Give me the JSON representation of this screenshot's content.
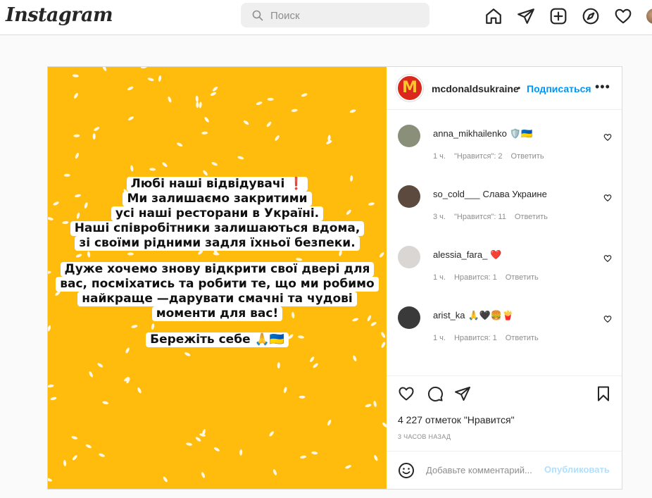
{
  "app": {
    "logo": "Instagram",
    "search_placeholder": "Поиск"
  },
  "nav_icons": [
    "home-icon",
    "direct-send-icon",
    "new-post-icon",
    "explore-compass-icon",
    "activity-heart-icon",
    "profile-avatar"
  ],
  "post": {
    "background_color": "#ffbc0d",
    "text_groups": [
      [
        "Любі наші відвідувачі ❗",
        "Ми залишаємо закритими",
        "усі наші ресторани в Україні.",
        "Наші співробітники залишаються вдома,",
        "зі своїми рідними задля їхньої безпеки."
      ],
      [
        "Дуже хочемо знову відкрити свої двері для",
        "вас, посміхатись та робити те, що ми робимо",
        "найкраще —дарувати смачні та чудові",
        "моменти для вас!"
      ],
      [
        "Бережіть себе 🙏🇺🇦"
      ]
    ],
    "author": "mcdonaldsukraine",
    "separator": "•",
    "follow_label": "Подписаться",
    "more_label": "•••",
    "likes_text": "4 227 отметок \"Нравится\"",
    "time_text": "3 ЧАСОВ НАЗАД",
    "comment_placeholder": "Добавьте комментарий...",
    "publish_label": "Опубликовать"
  },
  "comments": [
    {
      "user": "anna_mikhailenko",
      "text": "🛡️🇺🇦",
      "time": "1 ч.",
      "likes": "\"Нравится\": 2",
      "reply": "Ответить",
      "avatar_color": "#8a8f7a"
    },
    {
      "user": "so_cold___",
      "text": "Слава Украине",
      "time": "3 ч.",
      "likes": "\"Нравится\": 11",
      "reply": "Ответить",
      "avatar_color": "#5b4a3d"
    },
    {
      "user": "alessia_fara_",
      "text": "❤️",
      "time": "1 ч.",
      "likes": "Нравится: 1",
      "reply": "Ответить",
      "avatar_color": "#d9d6d3"
    },
    {
      "user": "arist_ka",
      "text": "🙏🖤🍔🍟",
      "time": "1 ч.",
      "likes": "Нравится: 1",
      "reply": "Ответить",
      "avatar_color": "#3a3a3a"
    }
  ]
}
